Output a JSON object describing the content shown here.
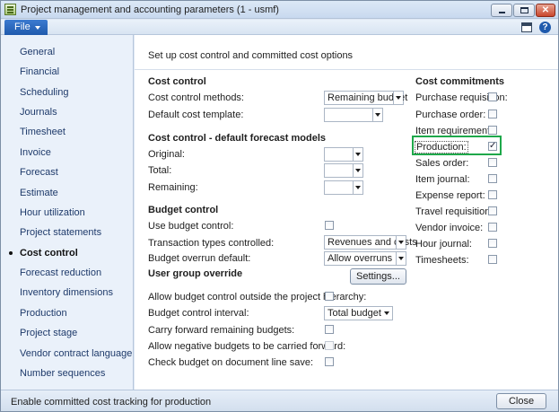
{
  "window": {
    "title": "Project management and accounting parameters (1 - usmf)",
    "app_icon": "form-icon",
    "controls": {
      "minimize": "minimize-icon",
      "maximize": "maximize-icon",
      "close": "✕"
    }
  },
  "menubar": {
    "file_label": "File",
    "icons": [
      "panel-toggle-icon",
      "help-icon"
    ],
    "help_glyph": "?"
  },
  "sidebar": {
    "items": [
      {
        "label": "General"
      },
      {
        "label": "Financial"
      },
      {
        "label": "Scheduling"
      },
      {
        "label": "Journals"
      },
      {
        "label": "Timesheet"
      },
      {
        "label": "Invoice"
      },
      {
        "label": "Forecast"
      },
      {
        "label": "Estimate"
      },
      {
        "label": "Hour utilization"
      },
      {
        "label": "Project statements"
      },
      {
        "label": "Cost control",
        "active": true
      },
      {
        "label": "Forecast reduction"
      },
      {
        "label": "Inventory dimensions"
      },
      {
        "label": "Production"
      },
      {
        "label": "Project stage"
      },
      {
        "label": "Vendor contract language"
      },
      {
        "label": "Number sequences"
      }
    ]
  },
  "content": {
    "intro": "Set up cost control and committed cost options",
    "cost_control": {
      "heading": "Cost control",
      "methods_label": "Cost control methods:",
      "methods_value": "Remaining budget",
      "template_label": "Default cost template:",
      "template_value": ""
    },
    "forecast_models": {
      "heading": "Cost control - default forecast models",
      "original_label": "Original:",
      "total_label": "Total:",
      "remaining_label": "Remaining:"
    },
    "budget_control": {
      "heading": "Budget control",
      "use_label": "Use budget control:",
      "use_checked": false,
      "transaction_label": "Transaction types controlled:",
      "transaction_value": "Revenues and costs",
      "overrun_label": "Budget overrun default:",
      "overrun_value": "Allow overruns",
      "group_override_label": "User group override",
      "settings_button": "Settings...",
      "outside_hierarchy_label": "Allow budget control outside the project hierarchy:",
      "interval_label": "Budget control interval:",
      "interval_value": "Total budget",
      "carry_forward_label": "Carry forward remaining budgets:",
      "negative_label": "Allow negative budgets to be carried forward:",
      "check_on_save_label": "Check budget on document line save:"
    },
    "commitments": {
      "heading": "Cost commitments",
      "items": [
        {
          "label": "Purchase requisition:",
          "checked": false
        },
        {
          "label": "Purchase order:",
          "checked": false
        },
        {
          "label": "Item requirement:",
          "checked": false
        },
        {
          "label": "Production:",
          "checked": true
        },
        {
          "label": "Sales order:",
          "checked": false
        },
        {
          "label": "Item journal:",
          "checked": false
        },
        {
          "label": "Expense report:",
          "checked": false
        },
        {
          "label": "Travel requisition:",
          "checked": false
        },
        {
          "label": "Vendor invoice:",
          "checked": false
        },
        {
          "label": "Hour journal:",
          "checked": false
        },
        {
          "label": "Timesheets:",
          "checked": false
        }
      ],
      "highlight_color": "#1ea84a"
    }
  },
  "status": {
    "text": "Enable committed cost tracking for production",
    "close_button": "Close"
  }
}
